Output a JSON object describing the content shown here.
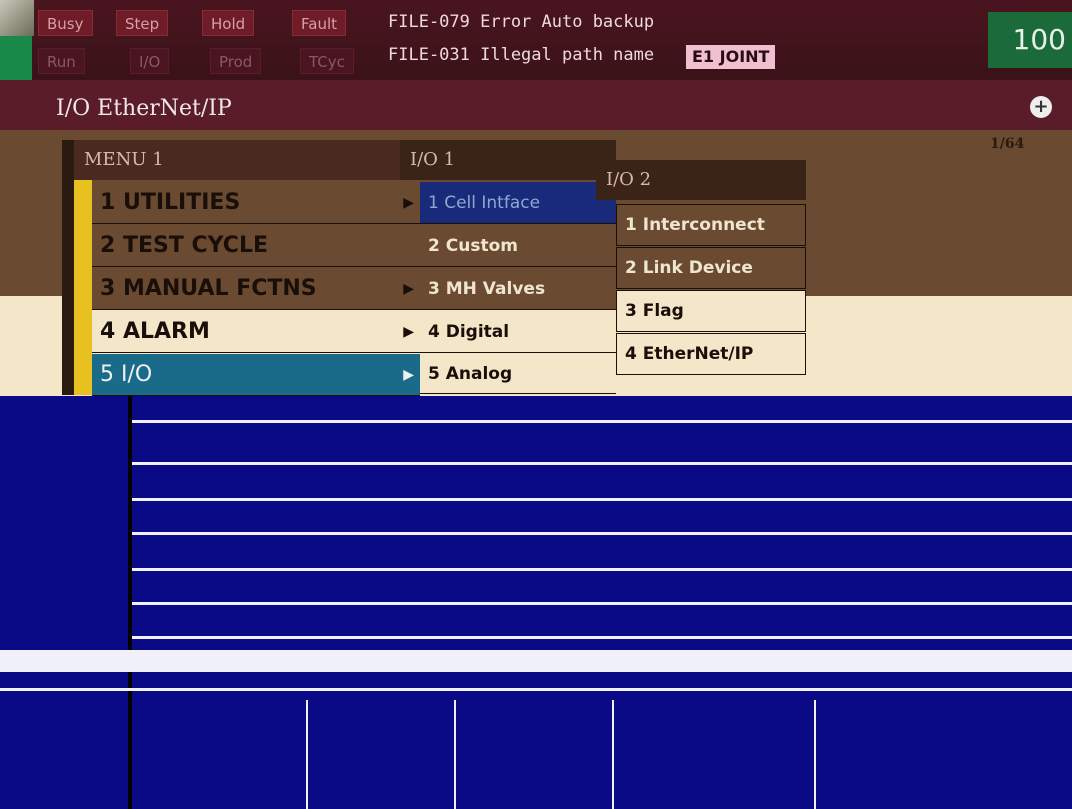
{
  "status": {
    "row1": [
      "Busy",
      "Step",
      "Hold",
      "Fault"
    ],
    "row2": [
      "Run",
      "I/O",
      "Prod",
      "TCyc"
    ]
  },
  "alarms": [
    "FILE-079 Error Auto backup",
    "FILE-031 Illegal path name"
  ],
  "joint_badge": "E1 JOINT",
  "speed": "100",
  "screen_title": "I/O EtherNet/IP",
  "page_count": "1/64",
  "menu1": {
    "title": "MENU 1",
    "items": [
      {
        "label": "1 UTILITIES",
        "arrow": true
      },
      {
        "label": "2 TEST CYCLE",
        "arrow": false
      },
      {
        "label": "3 MANUAL FCTNS",
        "arrow": true
      },
      {
        "label": "4 ALARM",
        "arrow": true
      },
      {
        "label": "5 I/O",
        "arrow": true
      }
    ]
  },
  "menu2": {
    "title": "I/O 1",
    "items": [
      {
        "label": "1 Cell Intface"
      },
      {
        "label": "2 Custom"
      },
      {
        "label": "3 MH Valves"
      },
      {
        "label": "4 Digital"
      },
      {
        "label": "5 Analog"
      }
    ]
  },
  "menu3": {
    "title": "I/O 2",
    "items": [
      {
        "label": "1 Interconnect"
      },
      {
        "label": "2 Link Device"
      },
      {
        "label": "3 Flag"
      },
      {
        "label": "4 EtherNet/IP"
      }
    ]
  },
  "colors": {
    "status_bg": "#4a1520",
    "menu_bg": "#6a4a30",
    "menu_highlight": "#f4e6c8",
    "menu_selected": "#1a6a8a",
    "lower_panel": "#0a0a86"
  }
}
